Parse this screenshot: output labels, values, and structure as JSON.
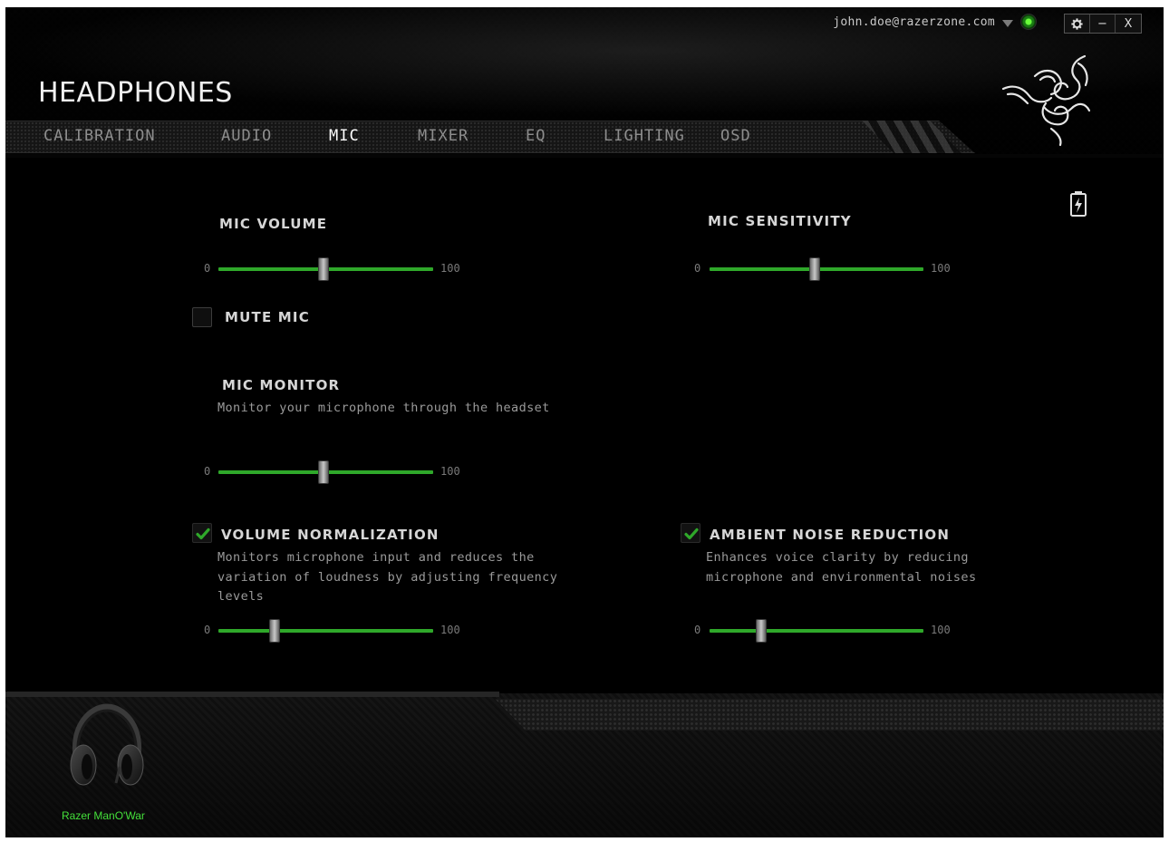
{
  "app": {
    "title": "HEADPHONES",
    "user_email": "john.doe@razerzone.com",
    "window_controls": {
      "settings_icon": "gear-icon",
      "minimize_label": "−",
      "close_label": "X"
    }
  },
  "tabs": [
    {
      "label": "CALIBRATION",
      "active": false
    },
    {
      "label": "AUDIO",
      "active": false
    },
    {
      "label": "MIC",
      "active": true
    },
    {
      "label": "MIXER",
      "active": false
    },
    {
      "label": "EQ",
      "active": false
    },
    {
      "label": "LIGHTING",
      "active": false
    },
    {
      "label": "OSD",
      "active": false
    }
  ],
  "mic_volume": {
    "title": "MIC VOLUME",
    "min_label": "0",
    "max_label": "100",
    "value_fraction": 0.49
  },
  "mic_sensitivity": {
    "title": "MIC SENSITIVITY",
    "min_label": "0",
    "max_label": "100",
    "value_fraction": 0.49
  },
  "mute_mic": {
    "label": "MUTE MIC",
    "checked": false
  },
  "mic_monitor": {
    "title": "MIC MONITOR",
    "description": "Monitor your microphone through the headset",
    "min_label": "0",
    "max_label": "100",
    "value_fraction": 0.49
  },
  "volume_normalization": {
    "title": "VOLUME NORMALIZATION",
    "checked": true,
    "description_lines": [
      "Monitors microphone input and reduces the",
      "variation of loudness by adjusting frequency",
      "levels"
    ],
    "min_label": "0",
    "max_label": "100",
    "value_fraction": 0.26
  },
  "ambient_noise_reduction": {
    "title": "AMBIENT NOISE REDUCTION",
    "checked": true,
    "description_lines": [
      "Enhances voice clarity by reducing",
      "microphone and environmental noises"
    ],
    "min_label": "0",
    "max_label": "100",
    "value_fraction": 0.24
  },
  "footer": {
    "device_name": "Razer ManO'War"
  },
  "colors": {
    "accent_green": "#2fa82a",
    "device_name_green": "#44e03a",
    "background": "#000000"
  }
}
